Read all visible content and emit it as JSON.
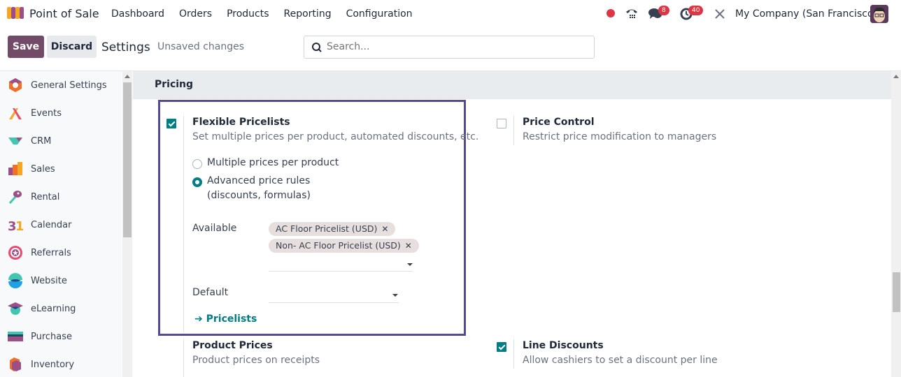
{
  "navbar": {
    "app_name": "Point of Sale",
    "menu": [
      "Dashboard",
      "Orders",
      "Products",
      "Reporting",
      "Configuration"
    ],
    "messages_badge": "8",
    "activities_badge": "40",
    "company": "My Company (San Francisco)"
  },
  "control_panel": {
    "save_label": "Save",
    "discard_label": "Discard",
    "title": "Settings",
    "status": "Unsaved changes",
    "search_placeholder": "Search..."
  },
  "sidebar": {
    "items": [
      {
        "label": "General Settings",
        "icon": "general-settings-icon"
      },
      {
        "label": "Events",
        "icon": "events-icon"
      },
      {
        "label": "CRM",
        "icon": "crm-icon"
      },
      {
        "label": "Sales",
        "icon": "sales-icon"
      },
      {
        "label": "Rental",
        "icon": "rental-icon"
      },
      {
        "label": "Calendar",
        "icon": "calendar-icon"
      },
      {
        "label": "Referrals",
        "icon": "referrals-icon"
      },
      {
        "label": "Website",
        "icon": "website-icon"
      },
      {
        "label": "eLearning",
        "icon": "elearning-icon"
      },
      {
        "label": "Purchase",
        "icon": "purchase-icon"
      },
      {
        "label": "Inventory",
        "icon": "inventory-icon"
      }
    ]
  },
  "section": {
    "title": "Pricing",
    "settings": {
      "flexible_pricelists": {
        "title": "Flexible Pricelists",
        "description": "Set multiple prices per product, automated discounts, etc.",
        "checked": true,
        "options": [
          {
            "label": "Multiple prices per product",
            "selected": false
          },
          {
            "label_line1": "Advanced price rules",
            "label_line2": "(discounts, formulas)",
            "selected": true
          }
        ],
        "available_label": "Available",
        "available_tags": [
          "AC Floor Pricelist (USD)",
          "Non- AC Floor Pricelist (USD)"
        ],
        "default_label": "Default",
        "default_value": "",
        "link_label": "Pricelists"
      },
      "price_control": {
        "title": "Price Control",
        "description": "Restrict price modification to managers",
        "checked": false
      },
      "product_prices": {
        "title": "Product Prices",
        "description": "Product prices on receipts"
      },
      "line_discounts": {
        "title": "Line Discounts",
        "description": "Allow cashiers to set a discount per line",
        "checked": true
      }
    }
  },
  "colors": {
    "brand": "#714b67",
    "accent": "#017e84",
    "highlight_border": "#574b90",
    "badge": "#dc3545"
  }
}
